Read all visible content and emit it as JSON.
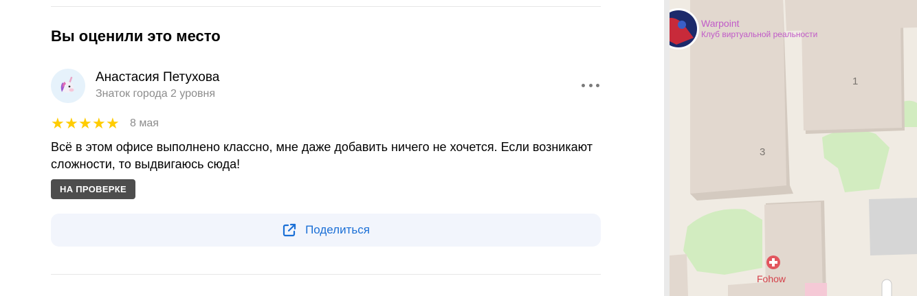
{
  "review_section": {
    "title": "Вы оценили это место",
    "author_name": "Анастасия Петухова",
    "author_level": "Знаток города 2 уровня",
    "rating": 5,
    "stars": [
      "★",
      "★",
      "★",
      "★",
      "★"
    ],
    "date": "8 мая",
    "text": "Всё в этом офисе выполнено классно, мне даже добавить ничего не хочется. Если возникают сложности, то выдвигаюсь сюда!",
    "status_badge": "НА ПРОВЕРКЕ",
    "share_label": "Поделиться",
    "avatar_icon": "unicorn-icon"
  },
  "map": {
    "place_name": "Warpoint",
    "place_category": "Клуб виртуальной реальности",
    "house_numbers": [
      "1",
      "3"
    ],
    "poi_label": "Fohow",
    "poi_icon": "medical-cross-icon",
    "colors": {
      "label": "#c05ac8",
      "poi": "#d4414a",
      "park": "#d2ecc0",
      "building": "#e2d8cf"
    }
  },
  "colors": {
    "star": "#ffcc00",
    "link": "#1a6fd6",
    "badge_bg": "#4d4d4d",
    "share_bg": "#f2f5fc"
  }
}
